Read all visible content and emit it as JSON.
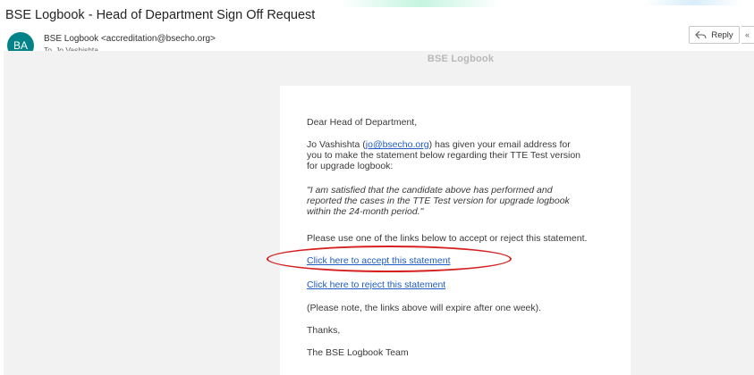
{
  "email": {
    "subject": "BSE Logbook - Head of Department Sign Off Request",
    "sender_initials": "BA",
    "sender": "BSE Logbook <accreditation@bsecho.org>",
    "to_label": "To",
    "recipient": "Jo Vashishta"
  },
  "toolbar": {
    "reply_label": "Reply",
    "more_label": "«"
  },
  "message": {
    "banner_title": "BSE Logbook",
    "greeting": "Dear Head of Department,",
    "para1_name": "Jo Vashishta (",
    "para1_email": "jo@bsecho.org",
    "para1_line1_rest": ") has given your email address for",
    "para1_line2": "you to make the statement below regarding their TTE Test version",
    "para1_line3": "for upgrade logbook:",
    "quote_line1": "\"I am satisfied that the candidate above has performed and",
    "quote_line2": "reported the cases in the TTE Test version for upgrade logbook",
    "quote_line3": "within the 24-month period.\"",
    "instruction": "Please use one of the links below to accept or reject this statement.",
    "accept_link": "Click here to accept this statement",
    "reject_link": "Click here to reject this statement",
    "note": "(Please note, the links above will expire after one week).",
    "thanks": "Thanks,",
    "signature": "The BSE Logbook Team"
  },
  "colors": {
    "avatar": "#038387",
    "link": "#1f5bc6",
    "highlight_circle": "#d62020"
  }
}
